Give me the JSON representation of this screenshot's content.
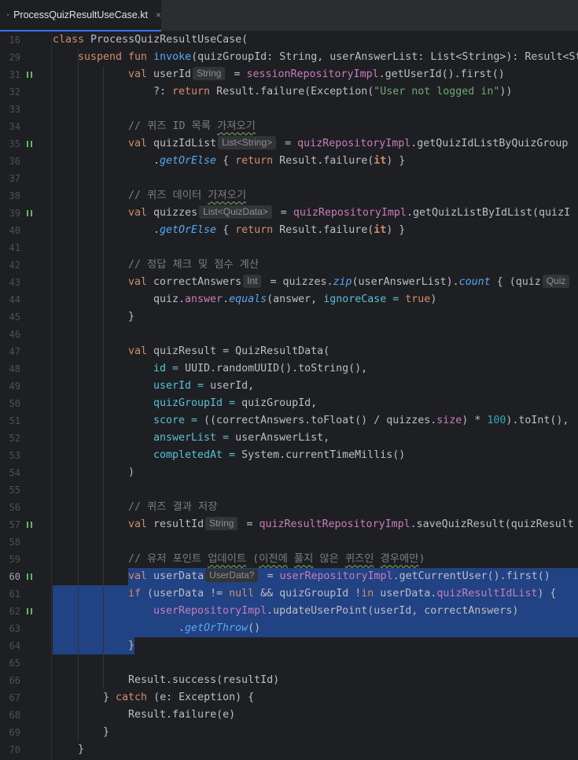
{
  "tab": {
    "title": "ProcessQuizResultUseCase.kt",
    "close_label": "×"
  },
  "lines": {
    "l16": "16",
    "l29": "29",
    "l31": "31",
    "l32": "32",
    "l33": "33",
    "l34": "34",
    "l35": "35",
    "l36": "36",
    "l37": "37",
    "l38": "38",
    "l39": "39",
    "l40": "40",
    "l41": "41",
    "l42": "42",
    "l43": "43",
    "l44": "44",
    "l45": "45",
    "l46": "46",
    "l47": "47",
    "l48": "48",
    "l49": "49",
    "l50": "50",
    "l51": "51",
    "l52": "52",
    "l53": "53",
    "l54": "54",
    "l55": "55",
    "l56": "56",
    "l57": "57",
    "l58": "58",
    "l59": "59",
    "l60": "60",
    "l61": "61",
    "l62": "62",
    "l63": "63",
    "l64": "64",
    "l65": "65",
    "l66": "66",
    "l67": "67",
    "l68": "68",
    "l69": "69",
    "l70": "70"
  },
  "hints": {
    "string1": "String",
    "list_string": "List<String>",
    "list_quizdata": "List<QuizData>",
    "int": "Int",
    "quiz_clip": "Quiz",
    "string2": "String",
    "userdata": "UserData?"
  },
  "code": {
    "c16_kw": "class ",
    "c16_rest": "ProcessQuizResultUseCase(",
    "c29_kw": "suspend fun ",
    "c29_fn": "invoke",
    "c29_rest": "(quizGroupId: String, userAnswerList: List<String>): Result<St",
    "c31_kw": "val ",
    "c31_name": "userId",
    "c31_eq": " = ",
    "c31_repo": "sessionRepositoryImpl",
    "c31_rest": ".getUserId().first()",
    "c32_pre": "?: ",
    "c32_kw": "return ",
    "c32_mid": "Result.failure(Exception(",
    "c32_str": "\"User not logged in\"",
    "c32_end": "))",
    "c34_cm": "// 퀴즈 ID 목록 ",
    "c34_cmw": "가져오기",
    "c35_kw": "val ",
    "c35_name": "quizIdList",
    "c35_eq": " = ",
    "c35_repo": "quizRepositoryImpl",
    "c35_rest": ".getQuizIdListByQuizGroup",
    "c36_dot": ".",
    "c36_fn": "getOrElse",
    "c36_b1": " { ",
    "c36_kw": "return ",
    "c36_mid": "Result.failure(",
    "c36_it": "it",
    "c36_end": ") }",
    "c38_cm": "// 퀴즈 데이터 ",
    "c38_cmw": "가져오기",
    "c39_kw": "val ",
    "c39_name": "quizzes",
    "c39_eq": " = ",
    "c39_repo": "quizRepositoryImpl",
    "c39_rest": ".getQuizListByIdList(quizI",
    "c40_dot": ".",
    "c40_fn": "getOrElse",
    "c40_b1": " { ",
    "c40_kw": "return ",
    "c40_mid": "Result.failure(",
    "c40_it": "it",
    "c40_end": ") }",
    "c42_cm": "// 정답 체크 및 점수 계산",
    "c43_kw": "val ",
    "c43_name": "correctAnswers",
    "c43_mid": " = quizzes.",
    "c43_zip": "zip",
    "c43_mid2": "(userAnswerList).",
    "c43_count": "count",
    "c43_end": " { (quiz",
    "c44_pre": "quiz.",
    "c44_ans": "answer",
    "c44_dot": ".",
    "c44_eq": "equals",
    "c44_mid": "(answer, ",
    "c44_arg": "ignoreCase = ",
    "c44_true": "true",
    "c44_end": ")",
    "c45": "}",
    "c47_kw": "val ",
    "c47_rest": "quizResult = QuizResultData(",
    "c48_arg": "id = ",
    "c48_rest": "UUID.randomUUID().toString(),",
    "c49_arg": "userId = ",
    "c49_rest": "userId,",
    "c50_arg": "quizGroupId = ",
    "c50_rest": "quizGroupId,",
    "c51_arg": "score = ",
    "c51_a": "((correctAnswers.toFloat() / quizzes.",
    "c51_size": "size",
    "c51_b": ") * ",
    "c51_num": "100",
    "c51_c": ").toInt(),",
    "c52_arg": "answerList = ",
    "c52_rest": "userAnswerList,",
    "c53_arg": "completedAt = ",
    "c53_rest": "System.currentTimeMillis()",
    "c54": ")",
    "c56_cm": "// 퀴즈 결과 저장",
    "c57_kw": "val ",
    "c57_name": "resultId",
    "c57_eq": " = ",
    "c57_repo": "quizResultRepositoryImpl",
    "c57_rest": ".saveQuizResult(quizResult",
    "c59_cm": "// 유저 포인트 ",
    "c59_cmw": "업데이트",
    "c59_cm2": " (",
    "c59_cmw2": "이전에",
    "c59_cm3": " ",
    "c59_cmw3": "풀지",
    "c59_cm4": " 않은 ",
    "c59_cmw4": "퀴즈인",
    "c59_cm5": " ",
    "c59_cmw5": "경우에만",
    "c59_cm6": ")",
    "c60_kw": "val ",
    "c60_name": "userData",
    "c60_eq": " = ",
    "c60_repo": "userRepositoryImpl",
    "c60_rest": ".getCurrentUser().first()",
    "c61_kw": "if ",
    "c61_a": "(userData != ",
    "c61_null": "null",
    "c61_b": " && quizGroupId !",
    "c61_in": "in",
    "c61_c": " userData.",
    "c61_list": "quizResultIdList",
    "c61_d": ") {",
    "c62_repo": "userRepositoryImpl",
    "c62_rest": ".updateUserPoint(userId, correctAnswers)",
    "c63_dot": ".",
    "c63_fn": "getOrThrow",
    "c63_end": "()",
    "c64": "}",
    "c66": "Result.success(resultId)",
    "c67_a": "} ",
    "c67_kw": "catch ",
    "c67_b": "(e: Exception) {",
    "c68": "Result.failure(e)",
    "c69": "}",
    "c70": "}"
  }
}
